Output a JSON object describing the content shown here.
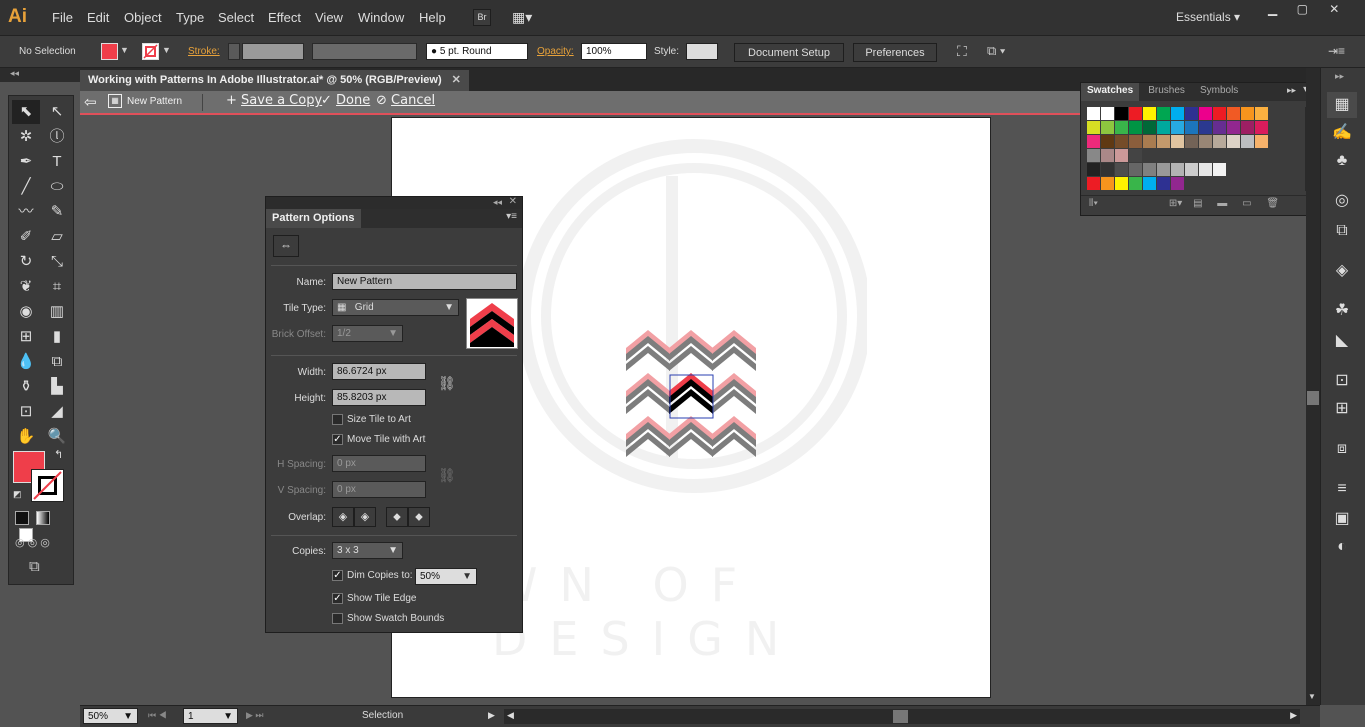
{
  "app": {
    "logo": "Ai",
    "workspace": "Essentials",
    "bridge": "Br"
  },
  "menu": [
    "File",
    "Edit",
    "Object",
    "Type",
    "Select",
    "Effect",
    "View",
    "Window",
    "Help"
  ],
  "control": {
    "selection": "No Selection",
    "stroke_label": "Stroke:",
    "stroke_profile": "5 pt. Round",
    "opacity_label": "Opacity:",
    "opacity_value": "100%",
    "style_label": "Style:",
    "document_setup": "Document Setup",
    "preferences": "Preferences"
  },
  "document": {
    "tab_title": "Working with Patterns In Adobe Illustrator.ai* @ 50% (RGB/Preview)"
  },
  "isolation": {
    "name": "New Pattern",
    "save_copy": "Save a Copy",
    "done": "Done",
    "cancel": "Cancel"
  },
  "pattern_options": {
    "title": "Pattern Options",
    "name_label": "Name:",
    "name_value": "New Pattern",
    "tile_type_label": "Tile Type:",
    "tile_type_value": "Grid",
    "brick_offset_label": "Brick Offset:",
    "brick_offset_value": "1/2",
    "width_label": "Width:",
    "width_value": "86.6724 px",
    "height_label": "Height:",
    "height_value": "85.8203 px",
    "size_tile_to_art": "Size Tile to Art",
    "move_tile_with_art": "Move Tile with Art",
    "h_spacing_label": "H Spacing:",
    "h_spacing_value": "0 px",
    "v_spacing_label": "V Spacing:",
    "v_spacing_value": "0 px",
    "overlap_label": "Overlap:",
    "copies_label": "Copies:",
    "copies_value": "3 x 3",
    "dim_copies_label": "Dim Copies to:",
    "dim_copies_value": "50%",
    "show_tile_edge": "Show Tile Edge",
    "show_swatch_bounds": "Show Swatch Bounds",
    "checks": {
      "size_tile_to_art": false,
      "move_tile_with_art": true,
      "dim_copies": true,
      "show_tile_edge": true,
      "show_swatch_bounds": false
    }
  },
  "swatches": {
    "tabs": [
      "Swatches",
      "Brushes",
      "Symbols"
    ]
  },
  "watermark": "WN OF DESIGN",
  "status": {
    "zoom": "50%",
    "page": "1",
    "tool": "Selection"
  },
  "colors": {
    "accent": "#e8a23a",
    "pink": "#ef8a8f",
    "fill": "#ef3e4a"
  }
}
